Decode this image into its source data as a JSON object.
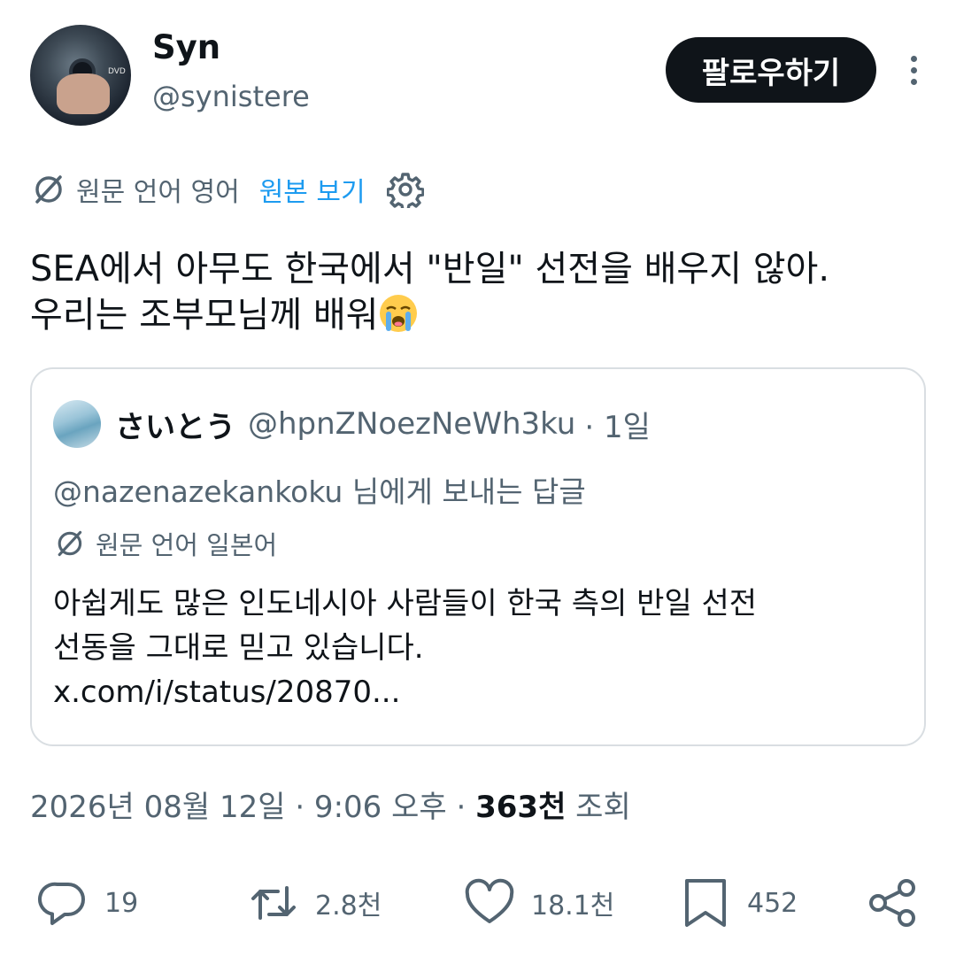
{
  "author": {
    "display_name": "Syn",
    "handle": "@synistere",
    "avatar_label": "DVD"
  },
  "header": {
    "follow_label": "팔로우하기",
    "more_icon": "more-vertical-icon"
  },
  "translation": {
    "original_language": "원문 언어 영어",
    "show_original": "원본 보기",
    "icon": "translate-icon",
    "settings_icon": "gear-icon"
  },
  "tweet": {
    "line1": "SEA에서 아무도 한국에서 \"반일\" 선전을 배우지 않아.",
    "line2": "우리는 조부모님께 배워",
    "emoji": "loudly-crying-face"
  },
  "quote": {
    "display_name": "さいとう",
    "handle": "@hpnZNoezNeWh3ku",
    "time": "· 1일",
    "reply_to": "@nazenazekankoku 님에게 보내는 답글",
    "original_language": "원문 언어 일본어",
    "body_line1": "아쉽게도 많은 인도네시아 사람들이 한국 측의 반일 선전",
    "body_line2": "선동을 그대로 믿고 있습니다.",
    "link": "x.com/i/status/20870..."
  },
  "meta": {
    "date": "2026년 08월 12일 · 9:06 오후 ·",
    "views_count": "363천",
    "views_label": "조회"
  },
  "actions": {
    "reply_count": "19",
    "retweet_count": "2.8천",
    "like_count": "18.1천",
    "bookmark_count": "452"
  },
  "colors": {
    "text": "#0f1419",
    "secondary": "#536471",
    "link": "#1d9bf0",
    "border": "#d9dee2"
  }
}
